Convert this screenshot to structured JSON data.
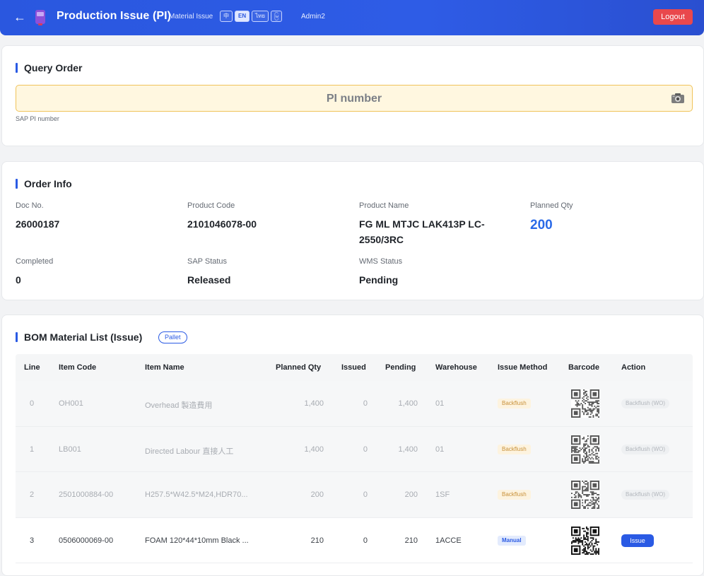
{
  "header": {
    "title": "Production Issue (PI)",
    "subtitle": "Material Issue",
    "languages": [
      "中",
      "EN",
      "ไทย",
      "မြ"
    ],
    "active_language": "EN",
    "user": "Admin2",
    "logout_label": "Logout"
  },
  "query": {
    "title": "Query Order",
    "placeholder": "PI number",
    "hint": "SAP PI number"
  },
  "order": {
    "title": "Order Info",
    "doc_no_label": "Doc No.",
    "doc_no": "26000187",
    "product_code_label": "Product Code",
    "product_code": "2101046078-00",
    "product_name_label": "Product Name",
    "product_name": "FG ML MTJC LAK413P LC-2550/3RC",
    "planned_qty_label": "Planned Qty",
    "planned_qty": "200",
    "completed_label": "Completed",
    "completed": "0",
    "sap_status_label": "SAP Status",
    "sap_status": "Released",
    "wms_status_label": "WMS Status",
    "wms_status": "Pending"
  },
  "bom": {
    "title": "BOM Material List (Issue)",
    "tag": "Pallet",
    "columns": [
      "Line",
      "Item Code",
      "Item Name",
      "Planned Qty",
      "Issued",
      "Pending",
      "Warehouse",
      "Issue Method",
      "Barcode",
      "Action"
    ],
    "rows": [
      {
        "line": "0",
        "item_code": "OH001",
        "item_name": "Overhead 製造費用",
        "planned": "1,400",
        "issued": "0",
        "pending": "1,400",
        "warehouse": "01",
        "method": "Backflush",
        "action": "Backflush (WO)"
      },
      {
        "line": "1",
        "item_code": "LB001",
        "item_name": "Directed Labour 直接人工",
        "planned": "1,400",
        "issued": "0",
        "pending": "1,400",
        "warehouse": "01",
        "method": "Backflush",
        "action": "Backflush (WO)"
      },
      {
        "line": "2",
        "item_code": "2501000884-00",
        "item_name": "H257.5*W42.5*M24,HDR70...",
        "planned": "200",
        "issued": "0",
        "pending": "200",
        "warehouse": "1SF",
        "method": "Backflush",
        "action": "Backflush (WO)"
      },
      {
        "line": "3",
        "item_code": "0506000069-00",
        "item_name": "FOAM 120*44*10mm Black ...",
        "planned": "210",
        "issued": "0",
        "pending": "210",
        "warehouse": "1ACCE",
        "method": "Manual",
        "action": "Issue"
      }
    ]
  },
  "colors": {
    "primary": "#2a57df",
    "logout": "#e9484c",
    "input_bg": "#fff7e0",
    "input_border": "#f0c35a"
  },
  "icons": {
    "back": "arrow-left-icon",
    "logo": "app-logo-icon",
    "camera": "camera-icon",
    "qr": "qr-code-icon"
  }
}
